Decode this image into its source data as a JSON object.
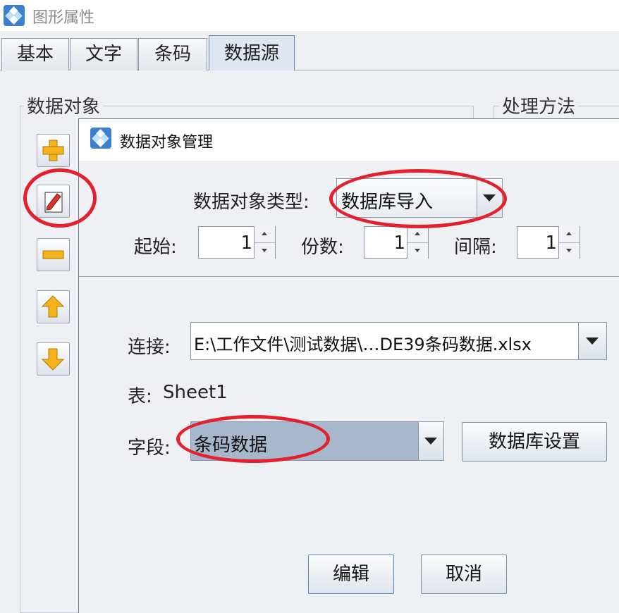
{
  "window": {
    "title": "图形属性"
  },
  "tabs": [
    {
      "label": "基本"
    },
    {
      "label": "文字"
    },
    {
      "label": "条码"
    },
    {
      "label": "数据源"
    }
  ],
  "groups": {
    "data_objects_label": "数据对象",
    "processing_label": "处理方法"
  },
  "side_buttons": [
    {
      "icon": "add-icon"
    },
    {
      "icon": "edit-icon"
    },
    {
      "icon": "remove-icon"
    },
    {
      "icon": "move-up-icon"
    },
    {
      "icon": "move-down-icon"
    }
  ],
  "dialog": {
    "title": "数据对象管理",
    "type_label": "数据对象类型:",
    "type_value": "数据库导入",
    "start_label": "起始:",
    "start_value": "1",
    "copies_label": "份数:",
    "copies_value": "1",
    "interval_label": "间隔:",
    "interval_value": "1",
    "connection_label": "连接:",
    "connection_value": "E:\\工作文件\\测试数据\\…DE39条码数据.xlsx",
    "table_label": "表:",
    "table_value": "Sheet1",
    "field_label": "字段:",
    "field_value": "条码数据",
    "db_settings_button": "数据库设置",
    "edit_button": "编辑",
    "cancel_button": "取消"
  },
  "colors": {
    "highlight_marker": "#e2202e",
    "selected_field_bg": "#a8b8cc",
    "accent": "#2f6db5"
  }
}
